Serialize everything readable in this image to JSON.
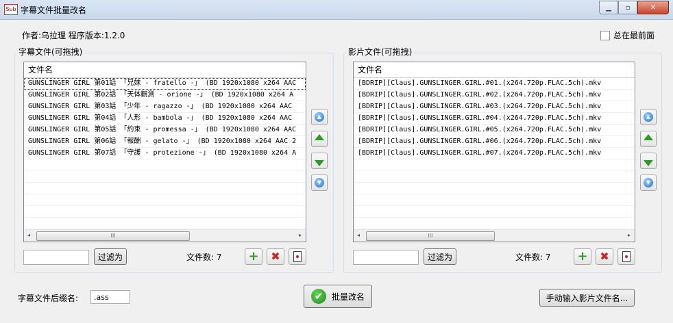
{
  "window": {
    "title": "字幕文件批量改名",
    "icon_text": "Sub"
  },
  "info": {
    "author": "作者:乌拉理  程序版本:1.2.0",
    "always_on_top_label": "总在最前面",
    "always_on_top_checked": false
  },
  "subtitle_panel": {
    "group_label": "字幕文件(可拖拽)",
    "column_header": "文件名",
    "rows": [
      "GUNSLINGER GIRL 第01話 「兄妹 - fratello -」 (BD 1920x1080 x264 AAC",
      "GUNSLINGER GIRL 第02話 「天体観測 - orione -」 (BD 1920x1080 x264 A",
      "GUNSLINGER GIRL 第03話 「少年 - ragazzo -」 (BD 1920x1080 x264 AAC",
      "GUNSLINGER GIRL 第04話 「人形 - bambola -」 (BD 1920x1080 x264 AAC",
      "GUNSLINGER GIRL 第05話 「約束 - promessa -」 (BD 1920x1080 x264 AAC",
      "GUNSLINGER GIRL 第06話 「報酬 - gelato -」 (BD 1920x1080 x264 AAC 2",
      "GUNSLINGER GIRL 第07話 「守護 - protezione -」 (BD 1920x1080 x264 A"
    ],
    "filter_value": "",
    "filter_button": "过滤为",
    "count_label": "文件数: 7"
  },
  "video_panel": {
    "group_label": "影片文件(可拖拽)",
    "column_header": "文件名",
    "rows": [
      "[BDRIP][Claus].GUNSLINGER.GIRL.#01.(x264.720p.FLAC.5ch).mkv",
      "[BDRIP][Claus].GUNSLINGER.GIRL.#02.(x264.720p.FLAC.5ch).mkv",
      "[BDRIP][Claus].GUNSLINGER.GIRL.#03.(x264.720p.FLAC.5ch).mkv",
      "[BDRIP][Claus].GUNSLINGER.GIRL.#04.(x264.720p.FLAC.5ch).mkv",
      "[BDRIP][Claus].GUNSLINGER.GIRL.#05.(x264.720p.FLAC.5ch).mkv",
      "[BDRIP][Claus].GUNSLINGER.GIRL.#06.(x264.720p.FLAC.5ch).mkv",
      "[BDRIP][Claus].GUNSLINGER.GIRL.#07.(x264.720p.FLAC.5ch).mkv"
    ],
    "filter_value": "",
    "filter_button": "过滤为",
    "count_label": "文件数: 7"
  },
  "footer": {
    "suffix_label": "字幕文件后缀名:",
    "suffix_value": ".ass",
    "rename_button": "批量改名",
    "manual_button": "手动输入影片文件名..."
  },
  "scrollbar": {
    "arrow_left": "◂",
    "arrow_right": "▸",
    "grip": "III"
  }
}
